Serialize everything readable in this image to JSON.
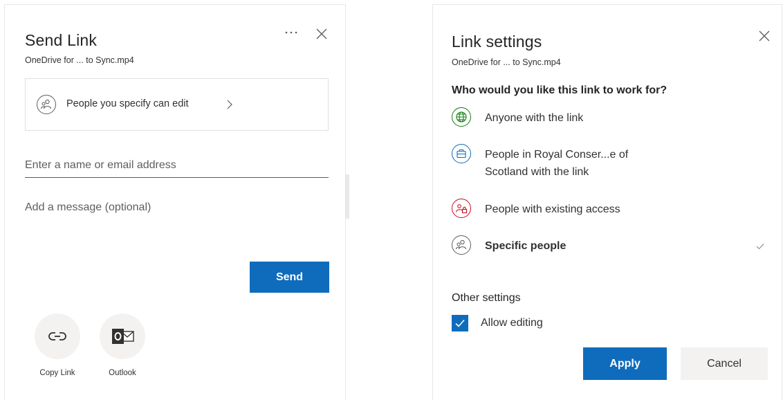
{
  "send_link": {
    "title": "Send Link",
    "subtitle": "OneDrive for ... to Sync.mp4",
    "permission": {
      "label": "People you specify can edit",
      "icon": "people-icon"
    },
    "recipient_placeholder": "Enter a name or email address",
    "message_placeholder": "Add a message (optional)",
    "send_label": "Send",
    "share_options": [
      {
        "label": "Copy Link",
        "icon": "link-icon"
      },
      {
        "label": "Outlook",
        "icon": "outlook-icon"
      }
    ],
    "icons": {
      "more": "ellipsis-icon",
      "close": "close-icon"
    }
  },
  "link_settings": {
    "title": "Link settings",
    "subtitle": "OneDrive for ... to Sync.mp4",
    "question": "Who would you like this link to work for?",
    "options": [
      {
        "label": "Anyone with the link",
        "icon": "globe-icon",
        "color": "#107c10",
        "selected": false
      },
      {
        "label_line1": "People in Royal Conser...e of",
        "label_line2": "Scotland with the link",
        "icon": "briefcase-icon",
        "color": "#0f6cbd",
        "selected": false
      },
      {
        "label": "People with existing access",
        "icon": "people-lock-icon",
        "color": "#c50f1f",
        "selected": false
      },
      {
        "label": "Specific people",
        "icon": "people-icon",
        "color": "#605e5c",
        "selected": true
      }
    ],
    "other_settings_heading": "Other settings",
    "allow_editing_label": "Allow editing",
    "allow_editing_checked": true,
    "apply_label": "Apply",
    "cancel_label": "Cancel"
  },
  "colors": {
    "accent": "#0f6cbd",
    "neutral_bg": "#f3f2f1",
    "text": "#323130"
  }
}
